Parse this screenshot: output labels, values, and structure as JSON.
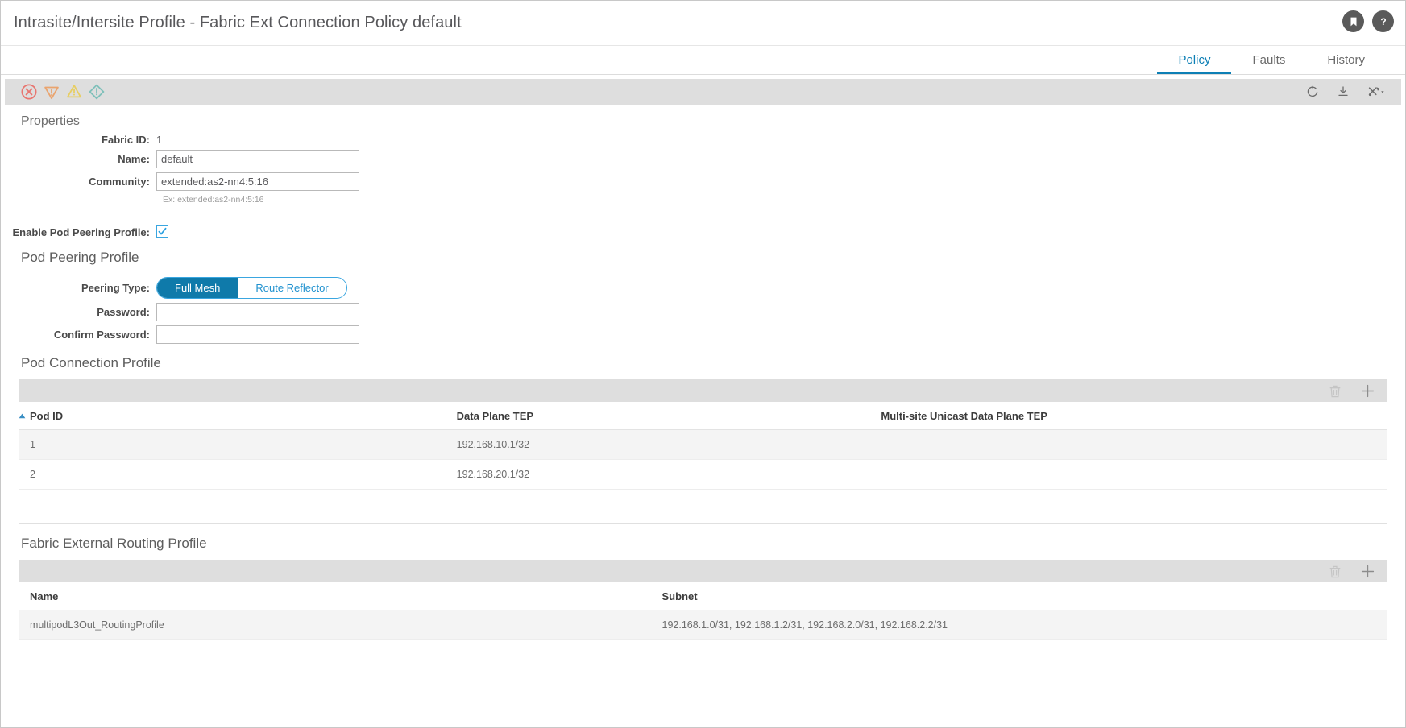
{
  "header": {
    "title": "Intrasite/Intersite Profile - Fabric Ext Connection Policy default",
    "bookmark_icon": "bookmark-icon",
    "help_icon": "help-icon"
  },
  "tabs": [
    {
      "label": "Policy",
      "active": true
    },
    {
      "label": "Faults",
      "active": false
    },
    {
      "label": "History",
      "active": false
    }
  ],
  "fault_toolbar": {
    "icons": [
      {
        "name": "critical-fault-icon",
        "color": "#e8756f"
      },
      {
        "name": "major-fault-icon",
        "color": "#eaa46e"
      },
      {
        "name": "minor-fault-icon",
        "color": "#ead56e"
      },
      {
        "name": "warning-fault-icon",
        "color": "#7fc0ba"
      }
    ],
    "actions": [
      {
        "name": "refresh-icon"
      },
      {
        "name": "download-icon"
      },
      {
        "name": "tools-menu-icon"
      }
    ]
  },
  "properties": {
    "heading": "Properties",
    "fabric_id_label": "Fabric ID:",
    "fabric_id_value": "1",
    "name_label": "Name:",
    "name_value": "default",
    "community_label": "Community:",
    "community_value": "extended:as2-nn4:5:16",
    "community_hint": "Ex: extended:as2-nn4:5:16",
    "enable_pod_peering_label": "Enable Pod Peering Profile:",
    "enable_pod_peering_checked": true
  },
  "pod_peering_profile": {
    "heading": "Pod Peering Profile",
    "peering_type_label": "Peering Type:",
    "peering_type_options": [
      "Full Mesh",
      "Route Reflector"
    ],
    "peering_type_selected": "Full Mesh",
    "password_label": "Password:",
    "password_value": "",
    "confirm_password_label": "Confirm Password:",
    "confirm_password_value": ""
  },
  "pod_connection_profile": {
    "heading": "Pod Connection Profile",
    "delete_icon": "trash-icon",
    "add_icon": "plus-icon",
    "columns": [
      "Pod ID",
      "Data Plane TEP",
      "Multi-site Unicast Data Plane TEP"
    ],
    "sorted_column": "Pod ID",
    "sort_direction": "ascending",
    "rows": [
      {
        "pod_id": "1",
        "data_plane_tep": "192.168.10.1/32",
        "multisite_unicast_tep": ""
      },
      {
        "pod_id": "2",
        "data_plane_tep": "192.168.20.1/32",
        "multisite_unicast_tep": ""
      }
    ]
  },
  "fabric_external_routing_profile": {
    "heading": "Fabric External Routing Profile",
    "delete_icon": "trash-icon",
    "add_icon": "plus-icon",
    "columns": [
      "Name",
      "Subnet"
    ],
    "rows": [
      {
        "name": "multipodL3Out_RoutingProfile",
        "subnet": "192.168.1.0/31, 192.168.1.2/31, 192.168.2.0/31, 192.168.2.2/31"
      }
    ]
  },
  "colors": {
    "accent": "#0d7fb5",
    "toggle_active": "#0f7aaa",
    "toolbar_bg": "#dedede",
    "row_alt": "#f4f4f4"
  }
}
